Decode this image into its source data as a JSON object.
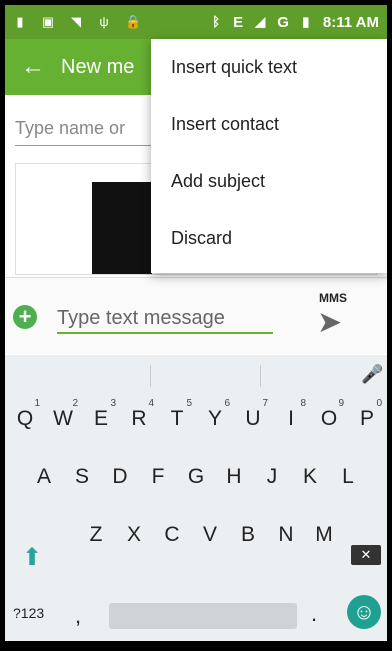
{
  "status_bar": {
    "network": "E",
    "network2": "G",
    "time": "8:11 AM",
    "left_icons": [
      "sim-card-icon",
      "image-icon",
      "wifi-icon",
      "usb-icon",
      "lock-icon"
    ],
    "right_icons": [
      "bluetooth-icon",
      "signal-icon",
      "battery-icon"
    ]
  },
  "app_bar": {
    "title": "New me",
    "back_icon": "arrow-left-icon"
  },
  "recipient": {
    "placeholder": "Type name or"
  },
  "compose": {
    "placeholder": "Type text message",
    "mms_label": "MMS",
    "send_icon": "send-icon"
  },
  "menu": {
    "items": [
      "Insert quick text",
      "Insert contact",
      "Add subject",
      "Discard"
    ]
  },
  "keyboard": {
    "row1": [
      {
        "key": "Q",
        "hint": "1"
      },
      {
        "key": "W",
        "hint": "2"
      },
      {
        "key": "E",
        "hint": "3"
      },
      {
        "key": "R",
        "hint": "4"
      },
      {
        "key": "T",
        "hint": "5"
      },
      {
        "key": "Y",
        "hint": "6"
      },
      {
        "key": "U",
        "hint": "7"
      },
      {
        "key": "I",
        "hint": "8"
      },
      {
        "key": "O",
        "hint": "9"
      },
      {
        "key": "P",
        "hint": "0"
      }
    ],
    "row2": [
      "A",
      "S",
      "D",
      "F",
      "G",
      "H",
      "J",
      "K",
      "L"
    ],
    "row3": [
      "Z",
      "X",
      "C",
      "V",
      "B",
      "N",
      "M"
    ],
    "symbols_label": "?123",
    "comma": ",",
    "period": "."
  },
  "colors": {
    "status_bar": "#5f9e2b",
    "app_bar": "#66b032",
    "accent_green": "#4caf50",
    "emoji_teal": "#20a090"
  }
}
